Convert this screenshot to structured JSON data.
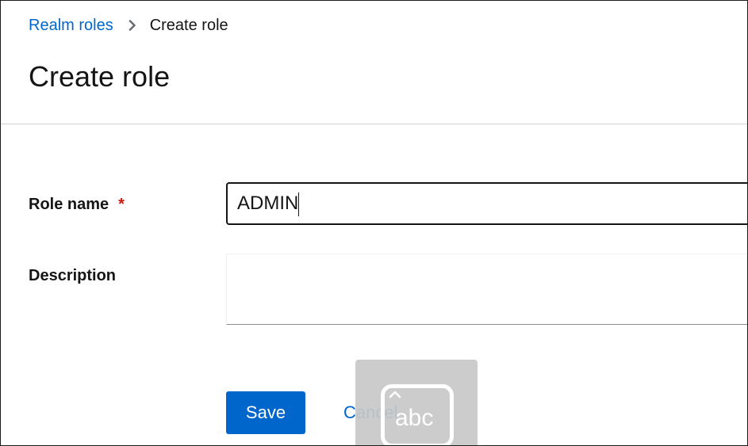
{
  "breadcrumb": {
    "parent_label": "Realm roles",
    "current_label": "Create role",
    "separator_icon": "chevron-right-icon"
  },
  "page": {
    "title": "Create role"
  },
  "form": {
    "role_name": {
      "label": "Role name",
      "required_marker": "*",
      "value": "ADMIN"
    },
    "description": {
      "label": "Description",
      "value": ""
    }
  },
  "actions": {
    "save_label": "Save",
    "cancel_label": "Cancel"
  },
  "handwriting_panel": {
    "icon": "handwriting-input-icon",
    "text": "abc"
  },
  "colors": {
    "link": "#0066cc",
    "primary_button": "#0066cc",
    "required": "#c9190b",
    "text": "#151515"
  }
}
